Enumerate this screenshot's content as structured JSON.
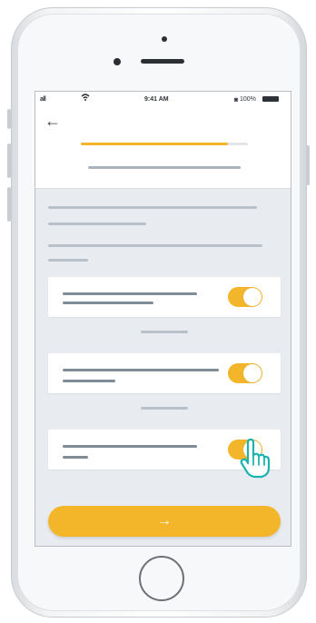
{
  "status_bar": {
    "signal": "all",
    "wifi": "wifi-icon",
    "time": "9:41 AM",
    "battery_percent": "100%",
    "bluetooth": "bluetooth-icon"
  },
  "header": {
    "back_icon": "arrow-left-icon",
    "progress": 0.88
  },
  "settings": [
    {
      "toggle_on": true
    },
    {
      "toggle_on": true
    },
    {
      "toggle_on": true
    }
  ],
  "cta": {
    "icon": "arrow-right-icon",
    "label": "→"
  },
  "colors": {
    "accent": "#f3b62a",
    "screen_bg": "#e8ecf0",
    "line": "#b8c0c8",
    "text_line": "#7f8b97",
    "cursor": "#1bb3b0"
  }
}
